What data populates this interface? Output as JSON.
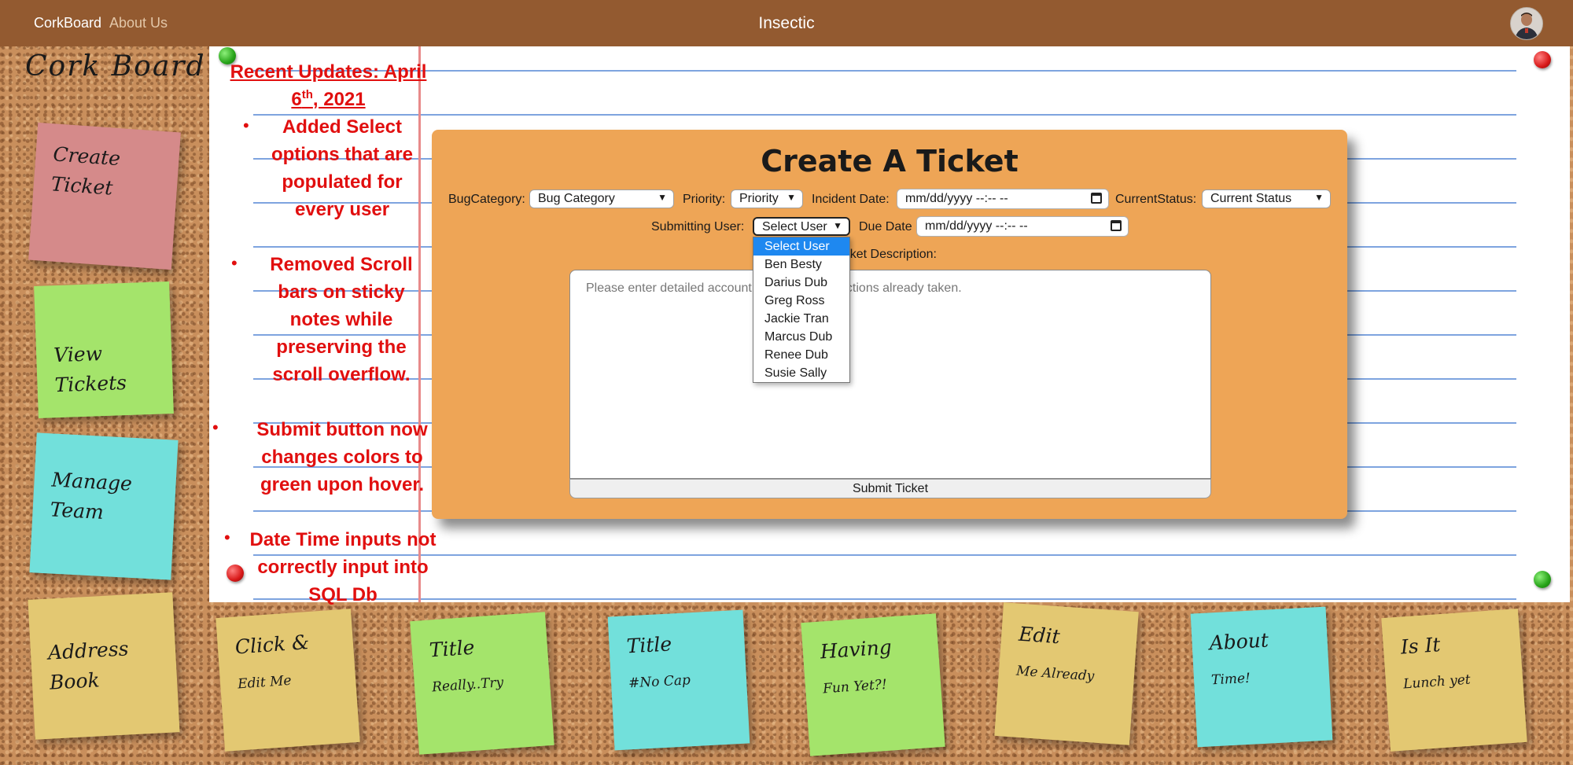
{
  "nav": {
    "brand": "CorkBoard",
    "about": "About Us",
    "title": "Insectic"
  },
  "sidebar": {
    "title": "Cork Board",
    "notes": [
      {
        "label": "Create Ticket",
        "color": "#d58a8a"
      },
      {
        "label": "View Tickets",
        "color": "#a4e46b"
      },
      {
        "label": "Manage Team",
        "color": "#72e0db"
      },
      {
        "label": "Address Book",
        "color": "#e3c872"
      }
    ]
  },
  "updates": {
    "heading_prefix": "Recent Updates: April",
    "heading_day": "6",
    "heading_suffix_sup": "th",
    "heading_year": ", 2021",
    "items": [
      "Added Select options that are populated for every user",
      "Removed Scroll bars on sticky notes while preserving the scroll overflow.",
      "Submit button now changes colors to green upon hover.",
      "Date Time inputs not correctly input into SQL Db"
    ]
  },
  "form": {
    "title": "Create A Ticket",
    "bug_category_label": "BugCategory:",
    "bug_category_value": "Bug Category",
    "priority_label": "Priority:",
    "priority_value": "Priority",
    "incident_date_label": "Incident Date:",
    "incident_date_value": "mm/dd/yyyy --:-- --",
    "status_label": "CurrentStatus:",
    "status_value": "Current Status",
    "submitting_user_label": "Submitting User:",
    "submitting_user_value": "Select User",
    "due_date_label": "Due Date",
    "due_date_value": "mm/dd/yyyy --:-- --",
    "description_label": "Ticket Description:",
    "description_placeholder": "Please enter detailed account of the bug and actions already taken.",
    "submit_label": "Submit Ticket",
    "user_options": [
      "Select User",
      "Ben Besty",
      "Darius Dub",
      "Greg Ross",
      "Jackie Tran",
      "Marcus Dub",
      "Renee Dub",
      "Susie Sally"
    ],
    "selected_user_index": 0
  },
  "bottom_notes": [
    {
      "title": "Click &",
      "subtitle": "Edit Me",
      "color": "#e3c872"
    },
    {
      "title": "Title",
      "subtitle": "Really..Try",
      "color": "#a4e46b"
    },
    {
      "title": "Title",
      "subtitle": "#No Cap",
      "color": "#72e0db"
    },
    {
      "title": "Having",
      "subtitle": "Fun Yet?!",
      "color": "#a4e46b"
    },
    {
      "title": "Edit",
      "subtitle": "Me Already",
      "color": "#e3c872"
    },
    {
      "title": "About",
      "subtitle": "Time!",
      "color": "#72e0db"
    },
    {
      "title": "Is It",
      "subtitle": "Lunch yet",
      "color": "#e3c872"
    }
  ]
}
